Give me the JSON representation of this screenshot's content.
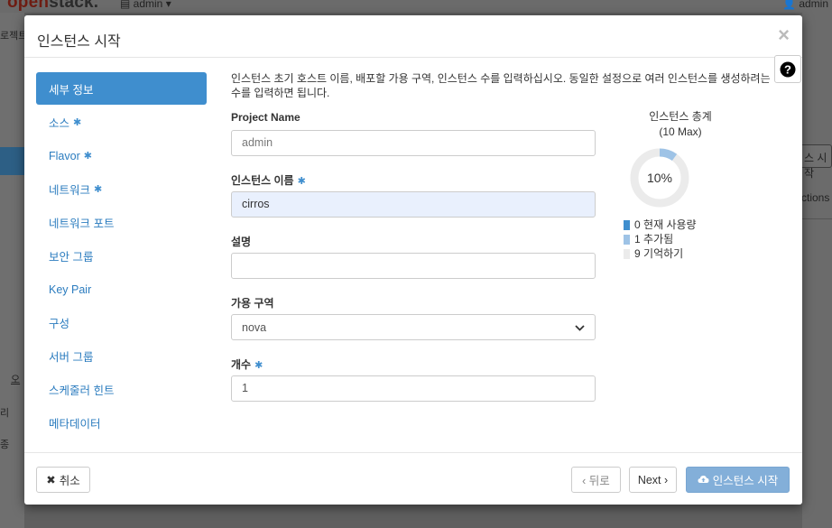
{
  "background": {
    "logo_prefix": "open",
    "logo_suffix": "stack.",
    "admin_menu": "admin",
    "user_menu": "admin",
    "side_texts": [
      "로젝트",
      "오",
      "리",
      "종"
    ],
    "right_button": "스 시작",
    "right_text": "ctions"
  },
  "modal": {
    "title": "인스턴스 시작",
    "close": "×",
    "help_icon": "question-circle-icon"
  },
  "nav": {
    "items": [
      {
        "label": "세부 정보",
        "required": false,
        "active": true
      },
      {
        "label": "소스",
        "required": true,
        "active": false
      },
      {
        "label": "Flavor",
        "required": true,
        "active": false
      },
      {
        "label": "네트워크",
        "required": true,
        "active": false
      },
      {
        "label": "네트워크 포트",
        "required": false,
        "active": false
      },
      {
        "label": "보안 그룹",
        "required": false,
        "active": false
      },
      {
        "label": "Key Pair",
        "required": false,
        "active": false
      },
      {
        "label": "구성",
        "required": false,
        "active": false
      },
      {
        "label": "서버 그룹",
        "required": false,
        "active": false
      },
      {
        "label": "스케줄러 힌트",
        "required": false,
        "active": false
      },
      {
        "label": "메타데이터",
        "required": false,
        "active": false
      }
    ],
    "required_mark": "✱"
  },
  "details": {
    "intro": "인스턴스 초기 호스트 이름, 배포할 가용 구역, 인스턴스 수를 입력하십시오. 동일한 설정으로 여러 인스턴스를 생성하려는 수를 입력하면 됩니다.",
    "project_name_label": "Project Name",
    "project_name_value": "admin",
    "instance_name_label": "인스턴스 이름",
    "instance_name_value": "cirros",
    "description_label": "설명",
    "description_value": "",
    "az_label": "가용 구역",
    "az_value": "nova",
    "count_label": "개수",
    "count_value": "1"
  },
  "summary": {
    "title_line1": "인스턴스 총계",
    "title_line2": "(10 Max)",
    "percent_label": "10%",
    "percent": 10,
    "legend": [
      {
        "count": "0",
        "label": "현재 사용량",
        "color": "#3f8ece"
      },
      {
        "count": "1",
        "label": "추가됨",
        "color": "#9ec3e6"
      },
      {
        "count": "9",
        "label": "기억하기",
        "color": "#ebebeb"
      }
    ]
  },
  "footer": {
    "cancel_label": "취소",
    "back_label": "‹ 뒤로",
    "next_label": "Next ›",
    "launch_label": "인스턴스 시작"
  }
}
